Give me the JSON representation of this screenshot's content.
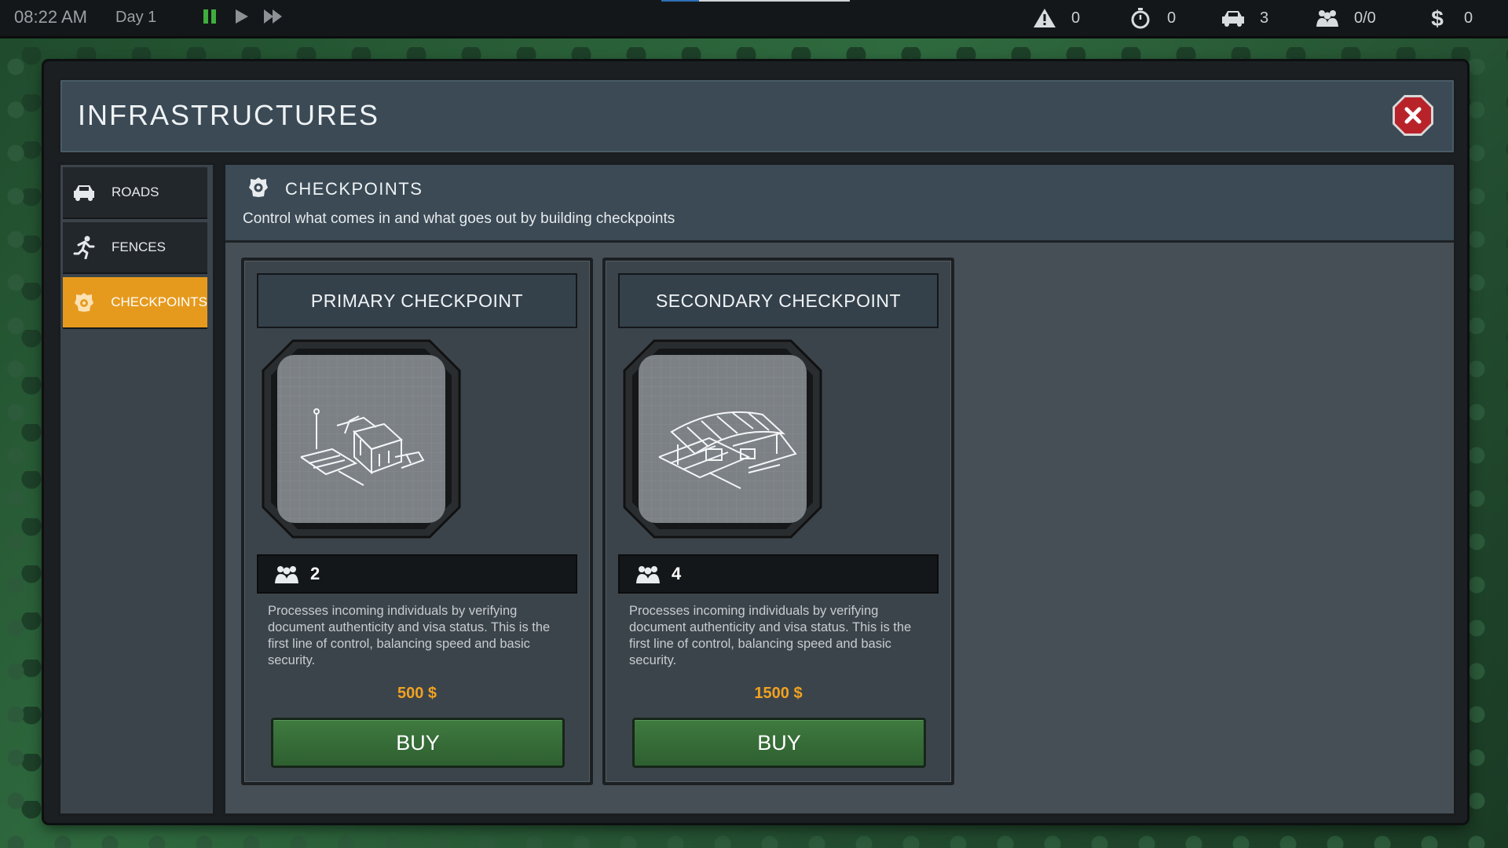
{
  "topbar": {
    "time": "08:22 AM",
    "day": "Day 1",
    "stats": {
      "alerts": "0",
      "timer": "0",
      "vehicles": "3",
      "people": "0/0",
      "money": "0"
    }
  },
  "window": {
    "title": "INFRASTRUCTURES"
  },
  "sidebar": {
    "items": [
      {
        "label": "ROADS",
        "icon": "car-icon"
      },
      {
        "label": "FENCES",
        "icon": "runner-icon"
      },
      {
        "label": "CHECKPOINTS",
        "icon": "badge-icon",
        "active": true
      }
    ]
  },
  "section": {
    "title": "CHECKPOINTS",
    "description": "Control what comes in and what goes out by building checkpoints"
  },
  "cards": [
    {
      "title": "PRIMARY CHECKPOINT",
      "staff": "2",
      "description": "Processes incoming individuals by verifying document authenticity and visa status. This is the first line of control, balancing speed and basic security.",
      "price": "500 $",
      "buy_label": "BUY"
    },
    {
      "title": "SECONDARY CHECKPOINT",
      "staff": "4",
      "description": "Processes incoming individuals by verifying document authenticity and visa status. This is the first line of control, balancing speed and basic security.",
      "price": "1500 $",
      "buy_label": "BUY"
    }
  ],
  "colors": {
    "accent": "#e69a1d",
    "price": "#f0a220",
    "buy": "#3f7a3f",
    "close": "#b8232a"
  }
}
